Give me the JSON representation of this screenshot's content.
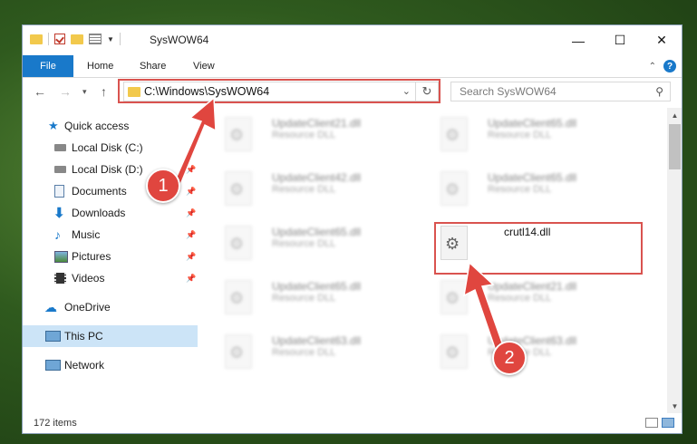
{
  "window": {
    "title": "SysWOW64",
    "controls": {
      "minimize": "—",
      "maximize": "☐",
      "close": "✕"
    }
  },
  "ribbon": {
    "tabs": [
      "File",
      "Home",
      "Share",
      "View"
    ]
  },
  "navigation": {
    "address": "C:\\Windows\\SysWOW64",
    "search_placeholder": "Search SysWOW64"
  },
  "sidebar": {
    "items": [
      {
        "label": "Quick access",
        "icon": "star-icon"
      },
      {
        "label": "Local Disk (C:)",
        "icon": "drive-icon"
      },
      {
        "label": "Local Disk (D:)",
        "icon": "drive-icon",
        "pinned": true
      },
      {
        "label": "Documents",
        "icon": "documents-icon",
        "pinned": true
      },
      {
        "label": "Downloads",
        "icon": "download-icon",
        "pinned": true
      },
      {
        "label": "Music",
        "icon": "music-icon",
        "pinned": true
      },
      {
        "label": "Pictures",
        "icon": "pictures-icon",
        "pinned": true
      },
      {
        "label": "Videos",
        "icon": "videos-icon",
        "pinned": true
      },
      {
        "label": "OneDrive",
        "icon": "cloud-icon"
      },
      {
        "label": "This PC",
        "icon": "computer-icon",
        "selected": true
      },
      {
        "label": "Network",
        "icon": "network-icon"
      }
    ]
  },
  "files": [
    {
      "name": "UpdateClient21.dll",
      "type": "Resource DLL"
    },
    {
      "name": "UpdateClient65.dll",
      "type": "Resource DLL"
    },
    {
      "name": "UpdateClient42.dll",
      "type": "Resource DLL"
    },
    {
      "name": "UpdateClient65.dll",
      "type": "Resource DLL"
    },
    {
      "name": "UpdateClient65.dll",
      "type": "Resource DLL"
    },
    {
      "name": "crutl14.dll",
      "type": ""
    },
    {
      "name": "UpdateClient65.dll",
      "type": "Resource DLL"
    },
    {
      "name": "UpdateClient21.dll",
      "type": "Resource DLL"
    },
    {
      "name": "UpdateClient63.dll",
      "type": "Resource DLL"
    },
    {
      "name": "UpdateClient63.dll",
      "type": "Resource DLL"
    }
  ],
  "status": {
    "item_count": "172 items"
  },
  "annotations": {
    "step1": "1",
    "step2": "2",
    "color": "#d9534f"
  }
}
